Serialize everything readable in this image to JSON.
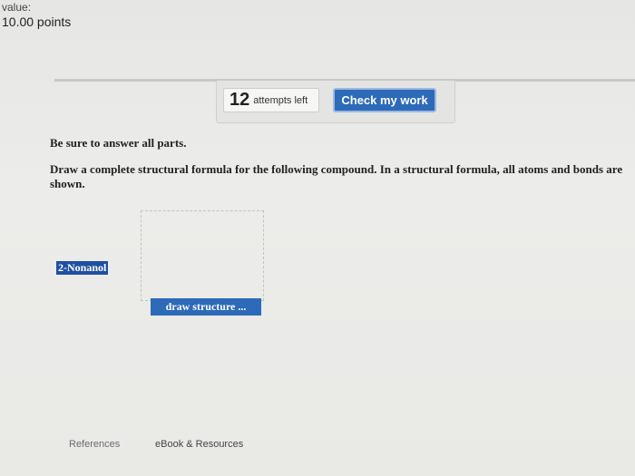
{
  "header": {
    "value_label": "value:",
    "points": "10.00 points"
  },
  "toolbar": {
    "attempts_count": "12",
    "attempts_text": "attempts left",
    "check_label": "Check my work"
  },
  "question": {
    "instruction_1": "Be sure to answer all parts.",
    "instruction_2": "Draw a complete structural formula for the following compound. In a structural formula, all atoms and bonds are shown.",
    "compound_name": "2-Nonanol",
    "draw_button_label": "draw structure ..."
  },
  "footer": {
    "references_label": "References",
    "ebook_label": "eBook & Resources"
  },
  "colors": {
    "accent": "#2d6ab8",
    "highlight": "#1f4fa0",
    "background": "#e9e9e7"
  }
}
